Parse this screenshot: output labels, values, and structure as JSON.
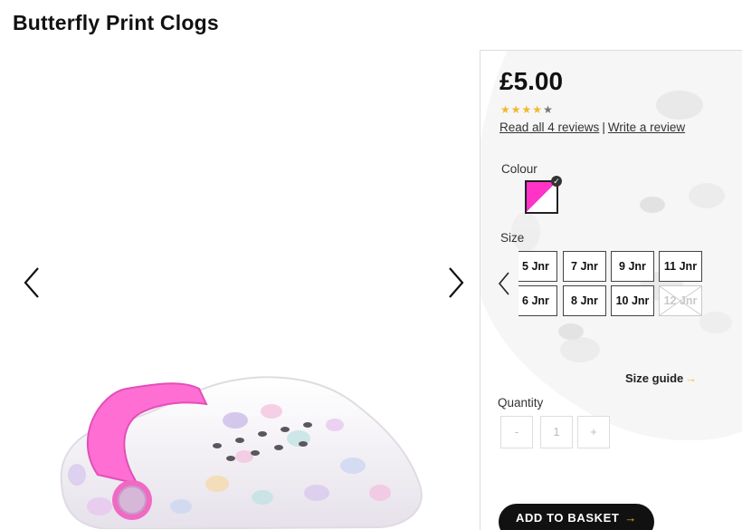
{
  "product": {
    "title": "Butterfly Print Clogs",
    "price": "£5.00",
    "rating": 4,
    "rating_max": 5,
    "reviews_link": "Read all 4 reviews",
    "separator": "|",
    "write_review_link": "Write a review"
  },
  "gallery": {
    "prev_icon": "chevron-left-icon",
    "next_icon": "chevron-right-icon"
  },
  "colour": {
    "label": "Colour",
    "selected_colors": [
      "#ff33c8",
      "#ffffff"
    ]
  },
  "size": {
    "label": "Size",
    "options_row1": [
      "5 Jnr",
      "7 Jnr",
      "9 Jnr",
      "11 Jnr"
    ],
    "options_row2": [
      "6 Jnr",
      "8 Jnr",
      "10 Jnr",
      "12 Jnr"
    ],
    "unavailable": [
      "12 Jnr"
    ],
    "guide_label": "Size guide",
    "guide_arrow": "→"
  },
  "quantity": {
    "label": "Quantity",
    "minus": "-",
    "value": "1",
    "plus": "+"
  },
  "basket": {
    "label": "ADD TO BASKET",
    "arrow": "→"
  },
  "colors": {
    "accent": "#f1b92b",
    "button_bg": "#111111"
  }
}
